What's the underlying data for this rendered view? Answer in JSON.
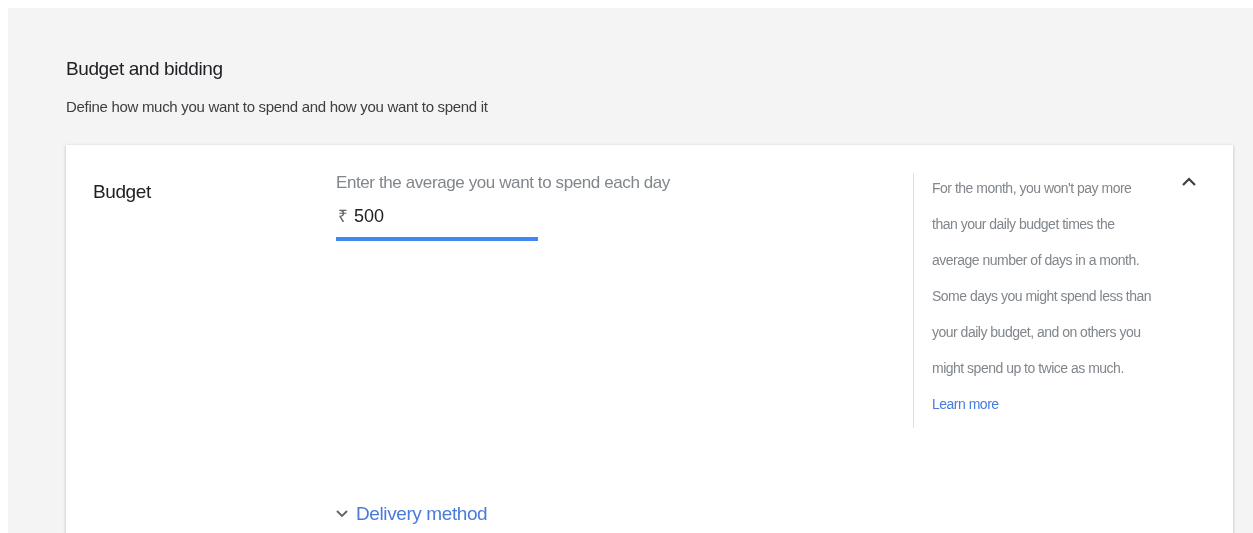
{
  "section": {
    "title": "Budget and bidding",
    "subtitle": "Define how much you want to spend and how you want to spend it"
  },
  "card": {
    "label": "Budget",
    "expanded": true,
    "field": {
      "label": "Enter the average you want to spend each day",
      "prefix": "₹",
      "value": "500",
      "focused": true
    },
    "help": {
      "text": "For the month, you won't pay more than your daily budget times the average number of days in a month. Some days you might spend less than your daily budget, and on others you might spend up to twice as much.",
      "link": "Learn more"
    },
    "delivery": {
      "label": "Delivery method",
      "expanded": false
    }
  }
}
